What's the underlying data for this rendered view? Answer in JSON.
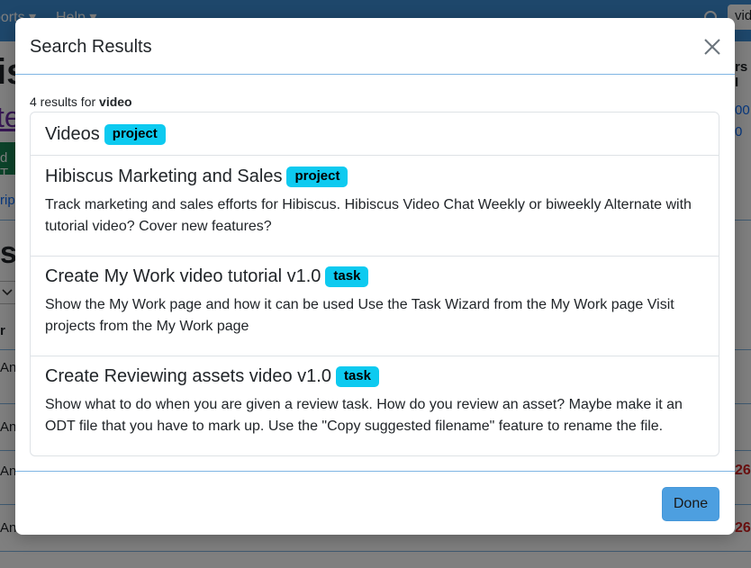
{
  "background": {
    "navbar": {
      "items": [
        "ports ▾",
        "Help ▾"
      ],
      "search_value": "vid"
    },
    "heading_fragment": "is",
    "link_fragment": "te",
    "green_button_fragment": "d T",
    "tab_fragment": "rip",
    "section_heading_fragment": "sk",
    "column_header_fragment": "r",
    "row_fragments": [
      "An",
      "An",
      "An",
      "An"
    ],
    "right_header_fragment": "rs I",
    "right_blue_values": [
      "00",
      "0"
    ],
    "right_red_values": [
      "26",
      "26"
    ]
  },
  "modal": {
    "title": "Search Results",
    "close_icon": "close-x-icon",
    "result_count_prefix": "4 results for",
    "query": "video",
    "results": [
      {
        "title": "Videos",
        "type": "project",
        "description": ""
      },
      {
        "title": "Hibiscus Marketing and Sales",
        "type": "project",
        "description": "Track marketing and sales efforts for Hibiscus. Hibiscus Video Chat Weekly or biweekly Alternate with tutorial video? Cover new features?"
      },
      {
        "title": "Create My Work video tutorial v1.0",
        "type": "task",
        "description": "Show the My Work page and how it can be used Use the Task Wizard from the My Work page Visit projects from the My Work page"
      },
      {
        "title": "Create Reviewing assets video v1.0",
        "type": "task",
        "description": "Show what to do when you are given a review task. How do you review an asset? Maybe make it an ODT file that you have to mark up. Use the \"Copy suggested filename\" feature to rename the file."
      }
    ],
    "done_label": "Done"
  },
  "colors": {
    "navbar": "#3d8fd6",
    "badge": "#0dcaf0",
    "done_button": "#4d9fe0",
    "divider": "#7fb5e3"
  }
}
